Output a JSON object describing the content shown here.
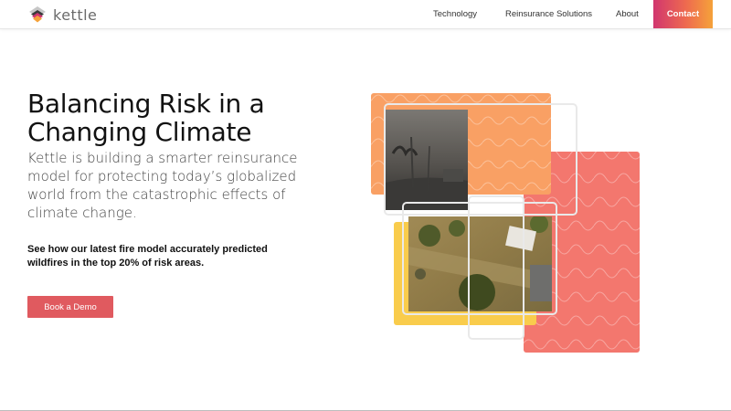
{
  "header": {
    "logo_text": "kettle",
    "nav": [
      {
        "label": "Technology",
        "name": "nav-technology"
      },
      {
        "label": "Reinsurance Solutions",
        "name": "nav-reinsurance-solutions"
      },
      {
        "label": "About",
        "name": "nav-about"
      }
    ],
    "contact_label": "Contact"
  },
  "hero": {
    "title": "Balancing Risk in a Changing Climate",
    "subtitle": "Kettle is building a smarter reinsurance model for protecting today’s globalized world from the catastrophic effects of climate change.",
    "promo": "See how our latest fire model accurately predicted wildfires in the top 20% of risk areas.",
    "cta_label": "Book a Demo"
  },
  "colors": {
    "accent": "#e05a5f",
    "orange": "#f9a064",
    "coral": "#f3776e",
    "yellow": "#f9cc4c",
    "contact_gradient": [
      "#d1366f",
      "#ee6a4f",
      "#f5a23a"
    ]
  }
}
